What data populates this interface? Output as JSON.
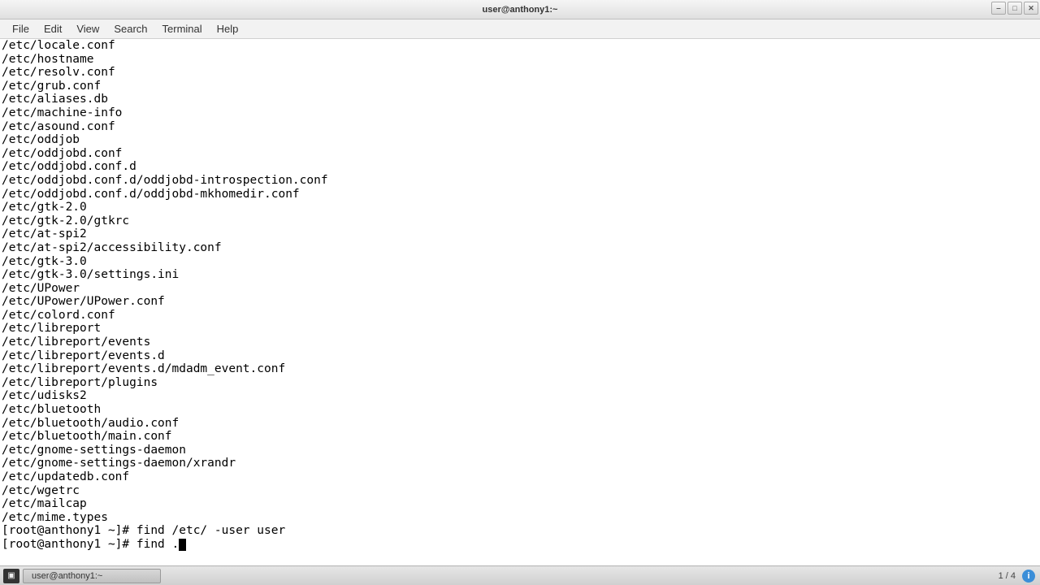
{
  "window": {
    "title": "user@anthony1:~"
  },
  "menubar": [
    "File",
    "Edit",
    "View",
    "Search",
    "Terminal",
    "Help"
  ],
  "terminal": {
    "output_lines": [
      "/etc/locale.conf",
      "/etc/hostname",
      "/etc/resolv.conf",
      "/etc/grub.conf",
      "/etc/aliases.db",
      "/etc/machine-info",
      "/etc/asound.conf",
      "/etc/oddjob",
      "/etc/oddjobd.conf",
      "/etc/oddjobd.conf.d",
      "/etc/oddjobd.conf.d/oddjobd-introspection.conf",
      "/etc/oddjobd.conf.d/oddjobd-mkhomedir.conf",
      "/etc/gtk-2.0",
      "/etc/gtk-2.0/gtkrc",
      "/etc/at-spi2",
      "/etc/at-spi2/accessibility.conf",
      "/etc/gtk-3.0",
      "/etc/gtk-3.0/settings.ini",
      "/etc/UPower",
      "/etc/UPower/UPower.conf",
      "/etc/colord.conf",
      "/etc/libreport",
      "/etc/libreport/events",
      "/etc/libreport/events.d",
      "/etc/libreport/events.d/mdadm_event.conf",
      "/etc/libreport/plugins",
      "/etc/udisks2",
      "/etc/bluetooth",
      "/etc/bluetooth/audio.conf",
      "/etc/bluetooth/main.conf",
      "/etc/gnome-settings-daemon",
      "/etc/gnome-settings-daemon/xrandr",
      "/etc/updatedb.conf",
      "/etc/wgetrc",
      "/etc/mailcap",
      "/etc/mime.types"
    ],
    "prev_prompt": "[root@anthony1 ~]# ",
    "prev_command": "find /etc/ -user user",
    "current_prompt": "[root@anthony1 ~]# ",
    "current_command": "find ."
  },
  "taskbar": {
    "app_label": "user@anthony1:~",
    "page_indicator": "1 / 4",
    "info_glyph": "i"
  }
}
